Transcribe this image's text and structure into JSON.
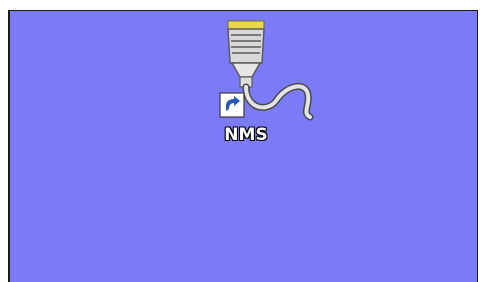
{
  "desktop": {
    "background_color": "#7b7bf7",
    "icons": [
      {
        "label": "NMS",
        "icon": "serial-cable-shortcut-icon",
        "overlay": "shortcut-arrow-icon"
      }
    ]
  }
}
